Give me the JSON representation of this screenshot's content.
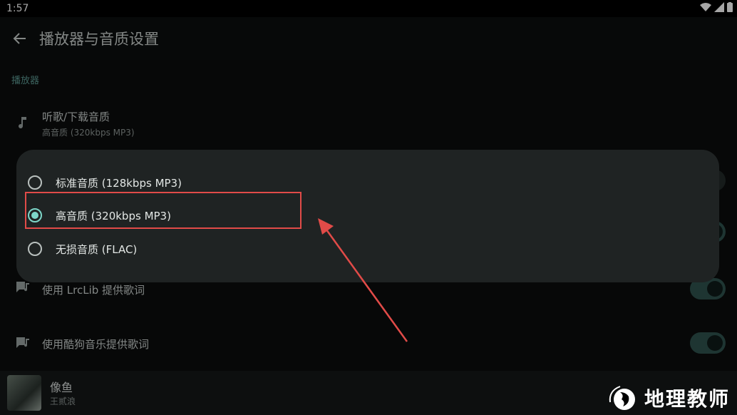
{
  "status_bar": {
    "time": "1:57"
  },
  "app_bar": {
    "title": "播放器与音质设置"
  },
  "section": {
    "label": "播放器"
  },
  "settings": [
    {
      "title": "听歌/下载音质",
      "subtitle": "高音质 (320kbps MP3)"
    },
    {
      "title": "使用 LrcLib 提供歌词",
      "switch_on": true
    },
    {
      "title": "使用酷狗音乐提供歌词",
      "switch_on": true
    }
  ],
  "dialog": {
    "options": [
      {
        "label": "标准音质 (128kbps MP3)",
        "selected": false
      },
      {
        "label": "高音质 (320kbps MP3)",
        "selected": true
      },
      {
        "label": "无损音质 (FLAC)",
        "selected": false
      }
    ]
  },
  "player": {
    "title": "像鱼",
    "artist": "王贰浪"
  },
  "watermark": {
    "text": "地理教师"
  },
  "colors": {
    "accent": "#7dd6c8",
    "annotation": "#e14b48",
    "switch_track": "#2e524e"
  }
}
